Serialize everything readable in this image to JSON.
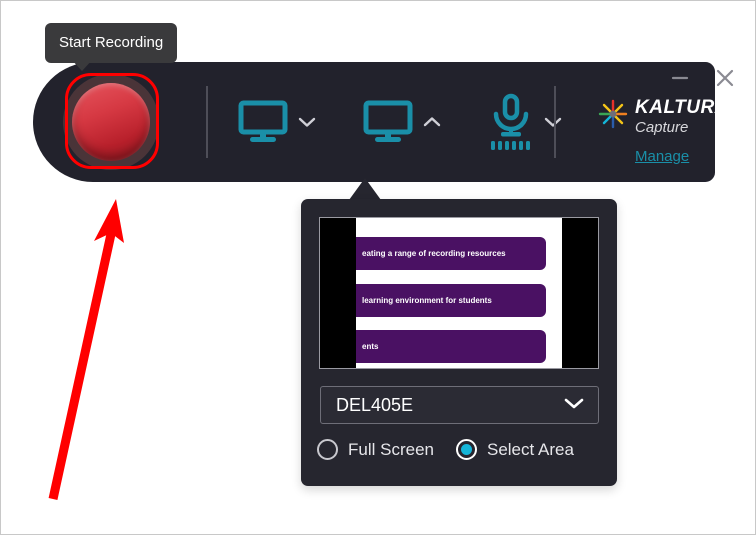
{
  "tooltip": {
    "text": "Start Recording"
  },
  "toolbar": {
    "record_button_name": "Start Recording",
    "screen_label": "Screen",
    "secondary_screen_label": "Screen",
    "audio_label": "Audio",
    "screen_chevron": "chevron-down",
    "secondary_screen_chevron": "chevron-up",
    "audio_chevron": "chevron-down",
    "accent_color": "#1a8fa8",
    "record_color": "#d63943",
    "background_color": "#22222c",
    "highlight_color": "#ff0000"
  },
  "brand": {
    "name": "KALTURA",
    "subtitle": "Capture",
    "manage_label": "Manage",
    "manage_color": "#1a8fa8",
    "logo_colors": [
      "#e8322a",
      "#f5c518",
      "#3aa655",
      "#14b5d8",
      "#2a5caa",
      "#f08020"
    ]
  },
  "window_controls": {
    "minimize_label": "Minimize",
    "close_label": "Close"
  },
  "panel": {
    "preview": {
      "slide_lines": [
        "eating a range of recording resources",
        "learning environment for students",
        "ents"
      ],
      "bar_color": "#4a1163",
      "slide_background": "#ffffff",
      "letterbox_color": "#000000"
    },
    "source_select": {
      "value": "DEL405E",
      "chevron": "chevron-down"
    },
    "capture_mode": {
      "options": [
        {
          "label": "Full Screen",
          "selected": false
        },
        {
          "label": "Select Area",
          "selected": true
        }
      ],
      "selected_color": "#14b5d8"
    }
  },
  "annotation": {
    "arrow_color": "#ff0000",
    "arrow_target": "record-button"
  }
}
